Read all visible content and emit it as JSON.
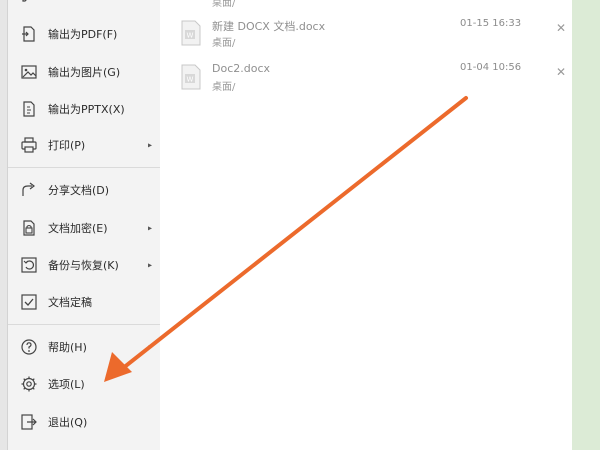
{
  "menu": {
    "items": [
      {
        "label": "输出为PDF(F)",
        "icon": "pdf-export-icon",
        "arrow": false
      },
      {
        "label": "输出为图片(G)",
        "icon": "image-export-icon",
        "arrow": false
      },
      {
        "label": "输出为PPTX(X)",
        "icon": "pptx-export-icon",
        "arrow": false
      },
      {
        "label": "打印(P)",
        "icon": "printer-icon",
        "arrow": true
      },
      {
        "label": "分享文档(D)",
        "icon": "share-icon",
        "arrow": false
      },
      {
        "label": "文档加密(E)",
        "icon": "encrypt-icon",
        "arrow": true
      },
      {
        "label": "备份与恢复(K)",
        "icon": "backup-restore-icon",
        "arrow": true
      },
      {
        "label": "文档定稿",
        "icon": "finalize-icon",
        "arrow": false
      },
      {
        "label": "帮助(H)",
        "icon": "help-icon",
        "arrow": true
      },
      {
        "label": "选项(L)",
        "icon": "gear-icon",
        "arrow": false
      },
      {
        "label": "退出(Q)",
        "icon": "exit-icon",
        "arrow": false
      }
    ],
    "submenu_arrow": "▸"
  },
  "recent_files": [
    {
      "name": "新建 DOCX 文档.docx",
      "path": "桌面/",
      "time": "01-15 16:33"
    },
    {
      "name": "Doc2.docx",
      "path": "桌面/",
      "time": "01-04 10:56"
    }
  ],
  "partial_top_path": "桌面/",
  "close_glyph": "✕",
  "colors": {
    "menu_bg": "#f3f3f3",
    "main_bg": "#ffffff",
    "arrow": "#ec6a2c",
    "accent_green": "#dcebd6"
  }
}
